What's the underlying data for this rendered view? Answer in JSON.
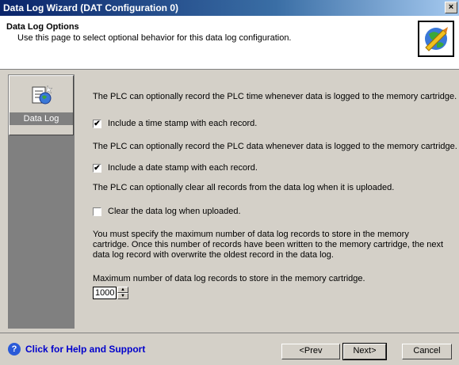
{
  "window": {
    "title": "Data Log Wizard (DAT Configuration 0)",
    "close_glyph": "×"
  },
  "header": {
    "title": "Data Log Options",
    "subtitle": "Use this page to select optional behavior for this data log configuration."
  },
  "sidebar": {
    "items": [
      {
        "label": "Data Log",
        "icon": "data-log-icon"
      }
    ]
  },
  "content": {
    "time_desc": "The PLC can optionally record the PLC time whenever data is logged to the memory cartridge.",
    "time_stamp": {
      "label": "Include a time stamp with each record.",
      "checked": true,
      "mark": "✔"
    },
    "date_desc": "The PLC can optionally record the PLC data whenever data is logged to the memory cartridge.",
    "date_stamp": {
      "label": "Include a date stamp with each record.",
      "checked": true,
      "mark": "✔"
    },
    "clear_desc": "The PLC can optionally clear all records from the data log when it is uploaded.",
    "clear_log": {
      "label": "Clear the data log when uploaded.",
      "checked": false,
      "mark": ""
    },
    "max_desc": "You must specify the maximum number of data log records to store in the memory cartridge. Once this number of records have been written to the memory cartridge, the next data log record with overwrite the oldest record in the data log.",
    "max_label": "Maximum number of data log records to store in the memory cartridge.",
    "max_value": "1000"
  },
  "footer": {
    "help_label": "Click for Help and Support",
    "help_glyph": "?",
    "prev_label": "<Prev",
    "next_label": "Next>",
    "cancel_label": "Cancel"
  }
}
